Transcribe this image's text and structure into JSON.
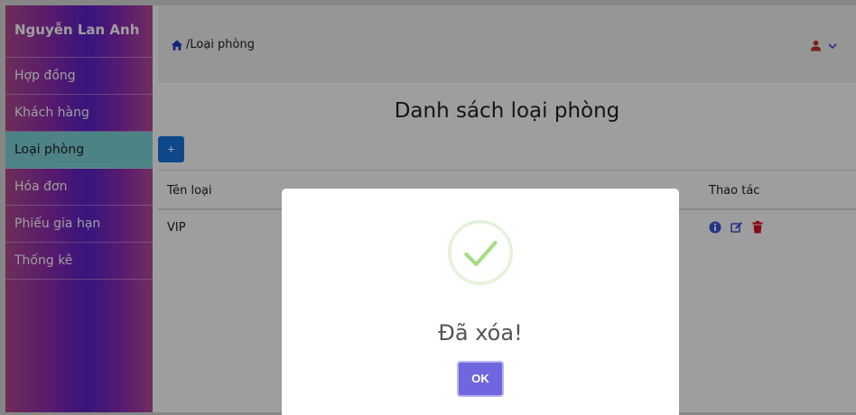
{
  "sidebar": {
    "brand": "Nguyễn Lan Anh",
    "items": [
      {
        "label": "Hợp đồng"
      },
      {
        "label": "Khách hàng"
      },
      {
        "label": "Loại phòng",
        "active": true
      },
      {
        "label": "Hóa đơn"
      },
      {
        "label": "Phiếu gia hạn"
      },
      {
        "label": "Thống kê"
      }
    ]
  },
  "header": {
    "breadcrumb": "/Loại phòng",
    "home_icon": "home-icon",
    "user_icon": "user-icon",
    "dropdown_icon": "chevron-down-icon"
  },
  "main": {
    "title": "Danh sách loại phòng",
    "add_label": "+",
    "table": {
      "columns": [
        "Tên loại",
        "Thao tác"
      ],
      "rows": [
        {
          "name": "VIP",
          "actions": [
            "info-icon",
            "edit-icon",
            "trash-icon"
          ]
        }
      ]
    }
  },
  "modal": {
    "icon": "success-check-icon",
    "title": "Đã xóa!",
    "ok_label": "OK"
  },
  "colors": {
    "add_button": "#1874e0",
    "active_item": "#7fd4d8",
    "ok_button": "#7066e0",
    "delete_icon": "#d9121e",
    "info_edit_icon": "#3a55d6",
    "success": "#a5dc86",
    "user_icon": "#c0392b"
  }
}
